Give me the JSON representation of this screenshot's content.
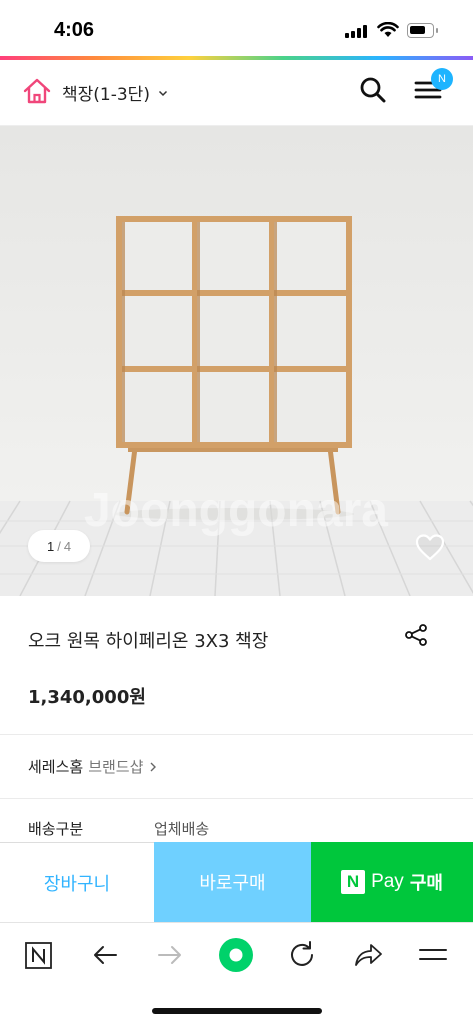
{
  "status_bar": {
    "time": "4:06",
    "battery_level": 0.75
  },
  "header": {
    "category_title": "책장(1-3단)",
    "menu_badge": "N",
    "icons": [
      "home-icon",
      "chevron-down-icon",
      "search-icon",
      "menu-icon"
    ]
  },
  "product_image": {
    "current": "1",
    "separator": "/",
    "total": "4",
    "watermark": "Joonggonara"
  },
  "product": {
    "title": "오크 원목 하이페리온 3X3 책장",
    "price": "1,340,000원",
    "brand_name": "세레스홈",
    "brand_shop": "브랜드샵",
    "shipping_label": "배송구분",
    "shipping_value": "업체배송"
  },
  "purchase_bar": {
    "cart": "장바구니",
    "buy_now": "바로구매",
    "npay_logo": "N",
    "npay_pay": "Pay",
    "npay_buy": "구매"
  },
  "browser_toolbar": {
    "buttons": [
      "naver-n-icon",
      "back-arrow-icon",
      "forward-arrow-icon",
      "green-dot-icon",
      "reload-icon",
      "share-arrow-icon",
      "menu-lines-icon"
    ]
  },
  "colors": {
    "accent_blue": "#32b4ff",
    "buy_now_bg": "#6fd0ff",
    "npay_green": "#00c73c",
    "home_pink": "#f0467a"
  }
}
